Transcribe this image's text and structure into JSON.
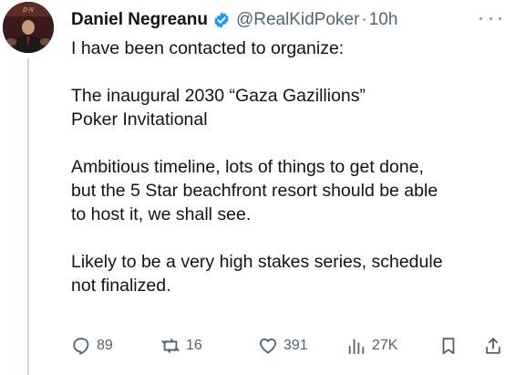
{
  "author": {
    "display_name": "Daniel Negreanu",
    "handle": "@RealKidPoker",
    "separator": "·",
    "time": "10h",
    "verified_color": "#1d9bf0"
  },
  "tweet": {
    "paragraphs": [
      "I have been contacted to organize:",
      "The inaugural 2030 “Gaza Gazillions”\nPoker Invitational",
      "Ambitious timeline, lots of things to get done,\nbut the 5 Star beachfront resort should be able\nto host it, we shall see.",
      "Likely to be a very high stakes series, schedule\nnot finalized."
    ]
  },
  "actions": {
    "replies": "89",
    "reposts": "16",
    "likes": "391",
    "views": "27K"
  },
  "icons": {
    "reply": "reply-icon",
    "repost": "repost-icon",
    "like": "heart-icon",
    "views": "views-icon",
    "bookmark": "bookmark-icon",
    "share": "share-icon",
    "more": "more-icon",
    "verified": "verified-badge-icon"
  }
}
